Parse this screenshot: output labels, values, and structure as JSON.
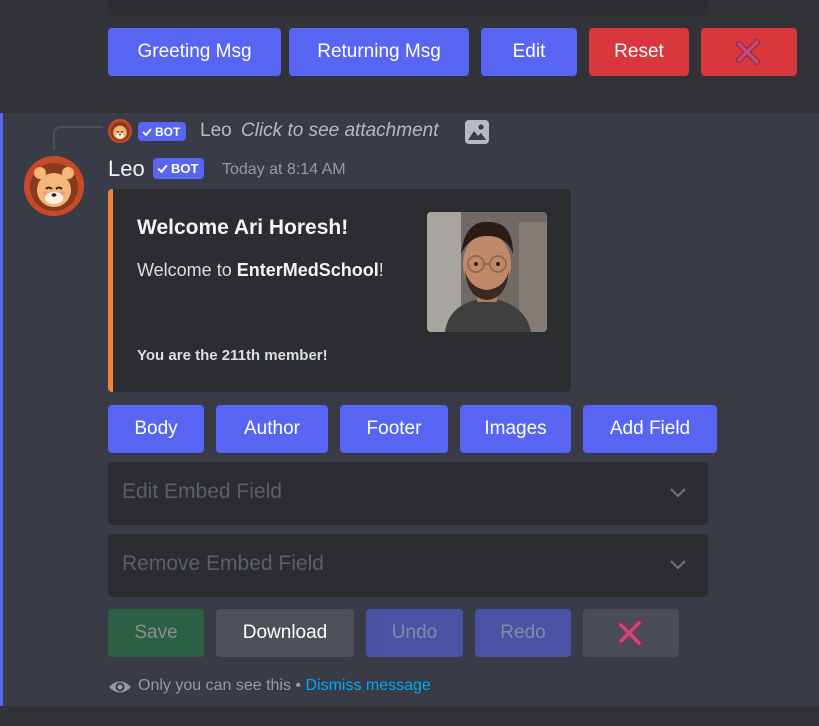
{
  "top_buttons": {
    "greeting": "Greeting Msg",
    "returning": "Returning Msg",
    "edit": "Edit",
    "reset": "Reset"
  },
  "reply": {
    "name": "Leo",
    "text": "Click to see attachment",
    "bot_tag": "BOT"
  },
  "message": {
    "username": "Leo",
    "bot_tag": "BOT",
    "timestamp": "Today at 8:14 AM"
  },
  "embed": {
    "title": "Welcome Ari Horesh!",
    "desc_prefix": "Welcome to ",
    "desc_bold": "EnterMedSchool",
    "desc_suffix": "!",
    "footer": "You are the 211th member!",
    "accent_color": "#f0813a"
  },
  "embed_buttons": {
    "body": "Body",
    "author": "Author",
    "footer": "Footer",
    "images": "Images",
    "add_field": "Add Field"
  },
  "selects": {
    "edit_field": "Edit Embed Field",
    "remove_field": "Remove Embed Field"
  },
  "action_buttons": {
    "save": "Save",
    "download": "Download",
    "undo": "Undo",
    "redo": "Redo"
  },
  "ephemeral": {
    "text": "Only you can see this",
    "separator": " • ",
    "dismiss": "Dismiss message"
  },
  "colors": {
    "blurple": "#5865f2",
    "danger": "#da373c",
    "link": "#00a8fc"
  },
  "icons": [
    "cross-mark-icon",
    "image-icon",
    "chevron-down-icon",
    "eye-icon",
    "checkmark-icon"
  ]
}
